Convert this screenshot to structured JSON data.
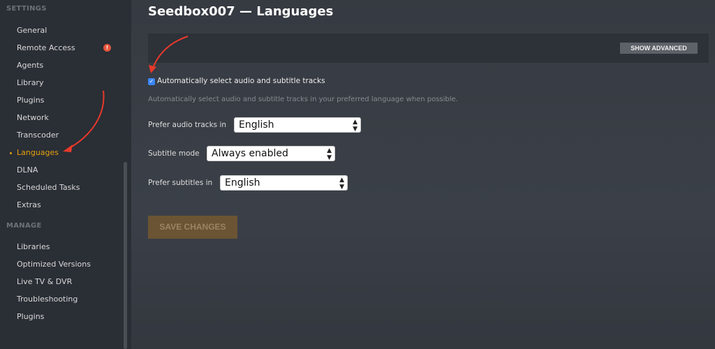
{
  "sidebar": {
    "settings_header": "SETTINGS",
    "settings_items": [
      "General",
      "Remote Access",
      "Agents",
      "Library",
      "Plugins",
      "Network",
      "Transcoder",
      "Languages",
      "DLNA",
      "Scheduled Tasks",
      "Extras"
    ],
    "active": "Languages",
    "manage_header": "MANAGE",
    "manage_items": [
      "Libraries",
      "Optimized Versions",
      "Live TV & DVR",
      "Troubleshooting",
      "Plugins"
    ],
    "warning_glyph": "!"
  },
  "page": {
    "title": "Seedbox007 — Languages",
    "show_advanced": "SHOW ADVANCED",
    "auto_select_label": "Automatically select audio and subtitle tracks",
    "auto_select_checked": true,
    "hint": "Automatically select audio and subtitle tracks in your preferred language when possible.",
    "audio_label": "Prefer audio tracks in",
    "audio_value": "English",
    "subtitle_mode_label": "Subtitle mode",
    "subtitle_mode_value": "Always enabled",
    "subtitles_label": "Prefer subtitles in",
    "subtitles_value": "English",
    "save": "SAVE CHANGES"
  },
  "colors": {
    "accent": "#e5a00d",
    "annotation": "#e8392b"
  }
}
